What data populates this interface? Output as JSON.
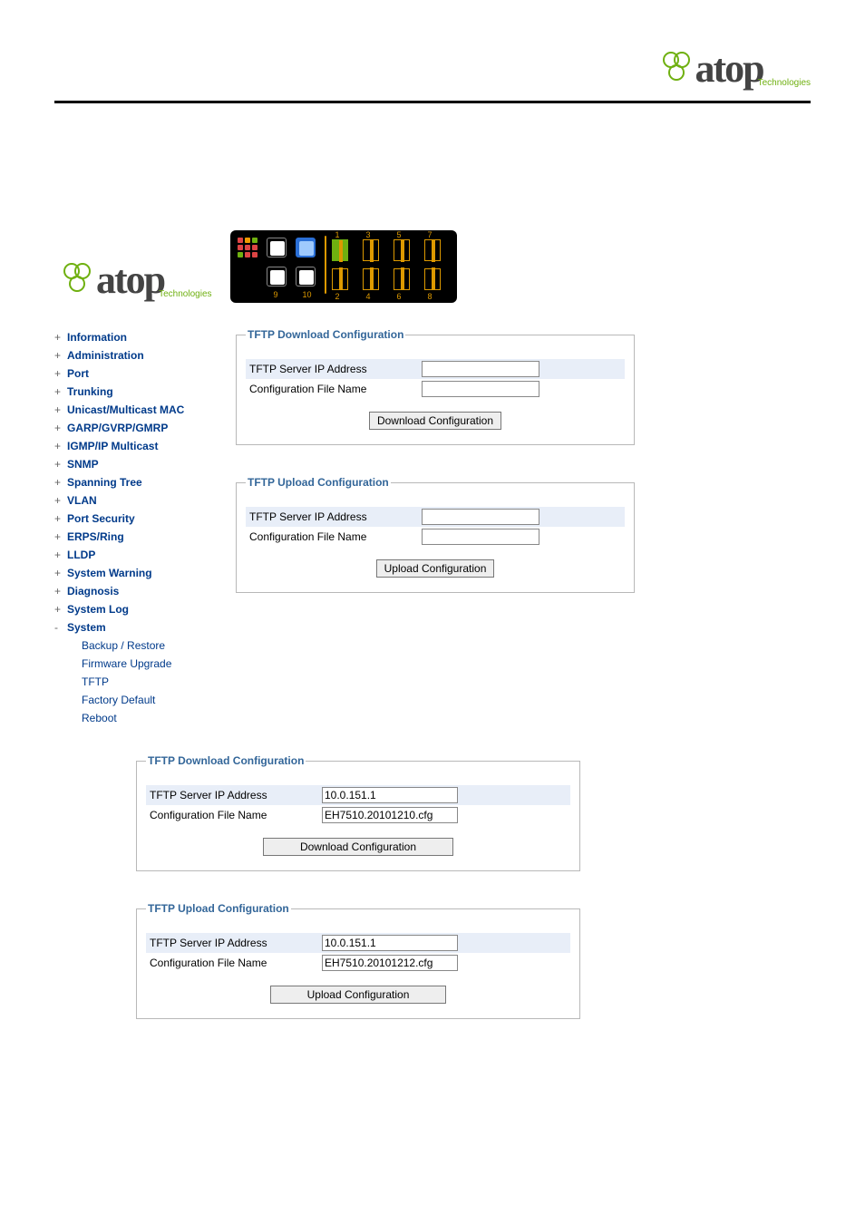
{
  "brand": {
    "name": "atop",
    "sub": "Technologies"
  },
  "sidebar": {
    "items": [
      {
        "label": "Information",
        "type": "collapsed"
      },
      {
        "label": "Administration",
        "type": "collapsed"
      },
      {
        "label": "Port",
        "type": "collapsed"
      },
      {
        "label": "Trunking",
        "type": "collapsed"
      },
      {
        "label": "Unicast/Multicast MAC",
        "type": "collapsed"
      },
      {
        "label": "GARP/GVRP/GMRP",
        "type": "collapsed"
      },
      {
        "label": "IGMP/IP Multicast",
        "type": "collapsed"
      },
      {
        "label": "SNMP",
        "type": "collapsed"
      },
      {
        "label": "Spanning Tree",
        "type": "collapsed"
      },
      {
        "label": "VLAN",
        "type": "collapsed"
      },
      {
        "label": "Port Security",
        "type": "collapsed"
      },
      {
        "label": "ERPS/Ring",
        "type": "collapsed"
      },
      {
        "label": "LLDP",
        "type": "collapsed"
      },
      {
        "label": "System Warning",
        "type": "collapsed"
      },
      {
        "label": "Diagnosis",
        "type": "collapsed"
      },
      {
        "label": "System Log",
        "type": "collapsed"
      },
      {
        "label": "System",
        "type": "expanded"
      }
    ],
    "system_children": [
      {
        "label": "Backup / Restore"
      },
      {
        "label": "Firmware Upgrade"
      },
      {
        "label": "TFTP"
      },
      {
        "label": "Factory Default"
      },
      {
        "label": "Reboot"
      }
    ]
  },
  "device_ports": {
    "top": [
      "1",
      "3",
      "5",
      "7"
    ],
    "bottom": [
      "2",
      "4",
      "6",
      "8"
    ],
    "uplink": [
      "9",
      "10"
    ]
  },
  "panel1": {
    "download": {
      "legend": "TFTP Download Configuration",
      "ip_label": "TFTP Server IP Address",
      "ip_value": "",
      "file_label": "Configuration File Name",
      "file_value": "",
      "button": "Download Configuration"
    },
    "upload": {
      "legend": "TFTP Upload Configuration",
      "ip_label": "TFTP Server IP Address",
      "ip_value": "",
      "file_label": "Configuration File Name",
      "file_value": "",
      "button": "Upload Configuration"
    }
  },
  "panel2": {
    "download": {
      "legend": "TFTP Download Configuration",
      "ip_label": "TFTP Server IP Address",
      "ip_value": "10.0.151.1",
      "file_label": "Configuration File Name",
      "file_value": "EH7510.20101210.cfg",
      "button": "Download Configuration"
    },
    "upload": {
      "legend": "TFTP Upload Configuration",
      "ip_label": "TFTP Server IP Address",
      "ip_value": "10.0.151.1",
      "file_label": "Configuration File Name",
      "file_value": "EH7510.20101212.cfg",
      "button": "Upload Configuration"
    }
  }
}
